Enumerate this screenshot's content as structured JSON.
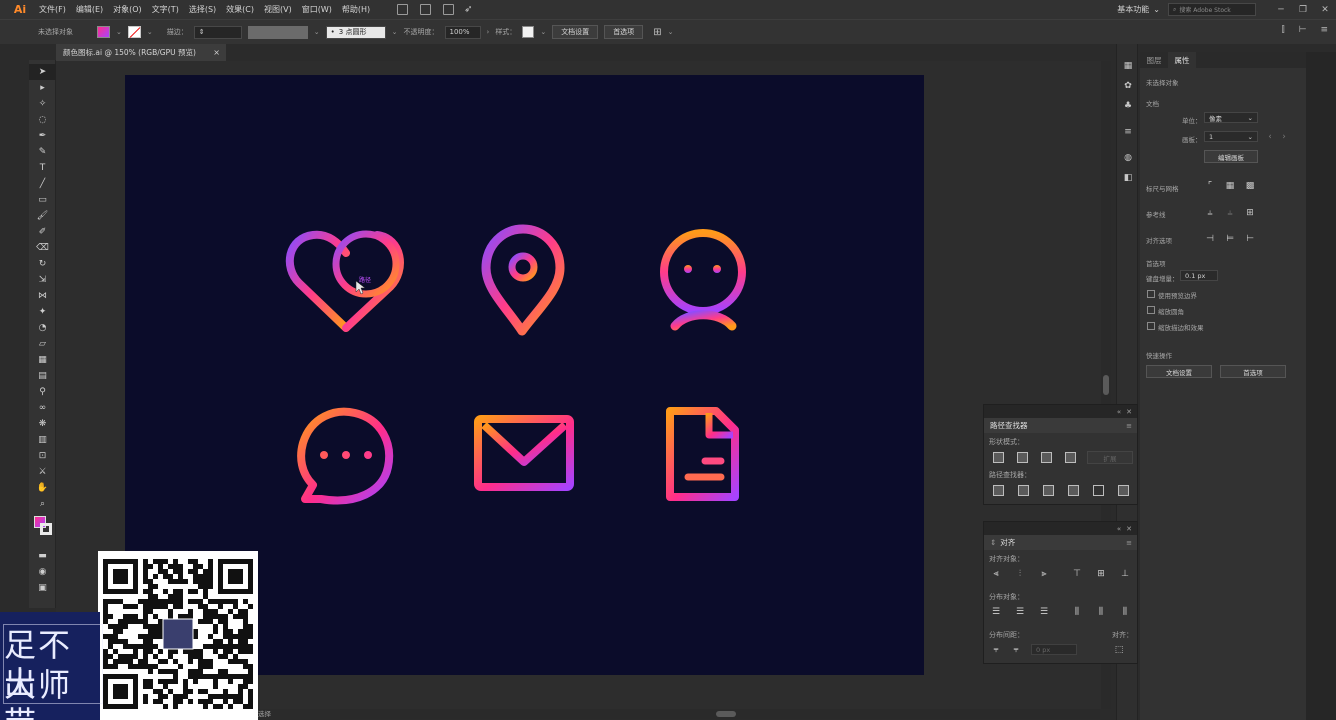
{
  "app": {
    "logo": "Ai",
    "menus": [
      "文件(F)",
      "编辑(E)",
      "对象(O)",
      "文字(T)",
      "选择(S)",
      "效果(C)",
      "视图(V)",
      "窗口(W)",
      "帮助(H)"
    ],
    "workspace": "基本功能",
    "stock_search_placeholder": "搜索 Adobe Stock"
  },
  "control_bar": {
    "no_selection": "未选择对象",
    "stroke_label": "描边：",
    "brush_label": "3 点圆形",
    "opacity_label": "不透明度：",
    "opacity_value": "100%",
    "style_label": "样式：",
    "doc_setup_button": "文档设置",
    "preferences_button": "首选项"
  },
  "document_tab": {
    "title": "颜色图标.ai @ 150% (RGB/GPU 预览)",
    "close": "×"
  },
  "canvas": {
    "artboard_color": "#0b0c2a",
    "gradient_start": "#ff9a1a",
    "gradient_mid": "#ff2d8b",
    "gradient_end": "#a643ff",
    "cursor_label": "路径",
    "icons": [
      "heart-icon",
      "location-pin-icon",
      "user-icon",
      "chat-bubble-icon",
      "mail-icon",
      "document-icon"
    ]
  },
  "properties_panel": {
    "tabs": [
      "图层",
      "属性"
    ],
    "active_tab": "属性",
    "no_selection": "未选择对象",
    "document_heading": "文档",
    "units_label": "单位：",
    "units_value": "像素",
    "artboard_label": "画板：",
    "artboard_value": "1",
    "edit_artboard_button": "编辑画板",
    "rulers_grids_label": "标尺与网格",
    "guides_label": "参考线",
    "snap_options_label": "对齐选项",
    "preferences_heading": "首选项",
    "keyboard_increment_label": "键盘增量：",
    "keyboard_increment_value": "0.1 px",
    "checkboxes": [
      "使用预览边界",
      "缩放圆角",
      "缩放描边和效果"
    ],
    "quick_actions_heading": "快速操作",
    "doc_setup_button": "文档设置",
    "preferences_button": "首选项"
  },
  "pathfinder_panel": {
    "title": "路径查找器",
    "shape_modes_label": "形状模式：",
    "expand_button": "扩展",
    "pathfinders_label": "路径查找器："
  },
  "align_panel": {
    "title": "对齐",
    "align_objects_label": "对齐对象：",
    "distribute_objects_label": "分布对象：",
    "distribute_spacing_label": "分布间距：",
    "spacing_value": "0 px",
    "align_to_label": "对齐："
  },
  "status": {
    "mode": "选择"
  },
  "watermark": {
    "line1": "足不出",
    "line2": "大师带"
  }
}
